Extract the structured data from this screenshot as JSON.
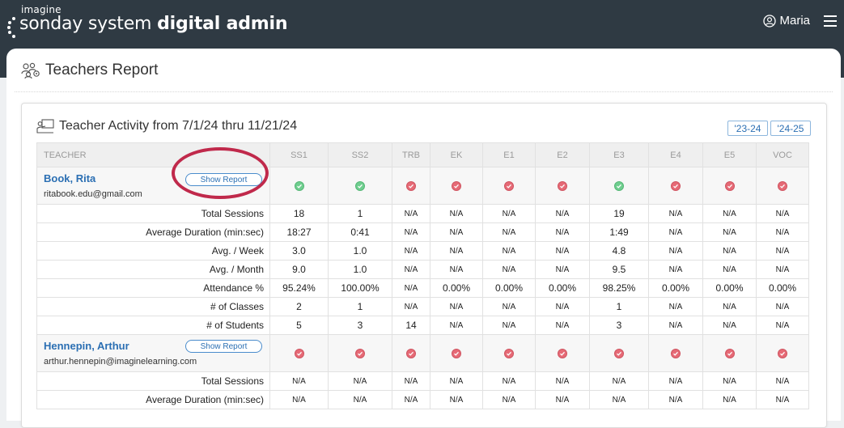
{
  "brand": {
    "small": "imagine",
    "main_light": "sonday system ",
    "main_bold": "digital admin"
  },
  "user": {
    "name": "Maria"
  },
  "page": {
    "title": "Teachers Report"
  },
  "card": {
    "title": "Teacher Activity from 7/1/24 thru 11/21/24",
    "year_buttons": [
      "'23-24",
      "'24-25"
    ]
  },
  "table": {
    "headers": [
      "TEACHER",
      "SS1",
      "SS2",
      "TRB",
      "EK",
      "E1",
      "E2",
      "E3",
      "E4",
      "E5",
      "VOC"
    ],
    "show_report_label": "Show Report",
    "stat_labels": [
      "Total Sessions",
      "Average Duration (min:sec)",
      "Avg. / Week",
      "Avg. / Month",
      "Attendance %",
      "# of Classes",
      "# of Students"
    ],
    "teachers": [
      {
        "name": "Book, Rita",
        "email": "ritabook.edu@gmail.com",
        "status": [
          "ok",
          "ok",
          "bad",
          "bad",
          "bad",
          "bad",
          "ok",
          "bad",
          "bad",
          "bad"
        ],
        "stats": [
          [
            "18",
            "1",
            "N/A",
            "N/A",
            "N/A",
            "N/A",
            "19",
            "N/A",
            "N/A",
            "N/A"
          ],
          [
            "18:27",
            "0:41",
            "N/A",
            "N/A",
            "N/A",
            "N/A",
            "1:49",
            "N/A",
            "N/A",
            "N/A"
          ],
          [
            "3.0",
            "1.0",
            "N/A",
            "N/A",
            "N/A",
            "N/A",
            "4.8",
            "N/A",
            "N/A",
            "N/A"
          ],
          [
            "9.0",
            "1.0",
            "N/A",
            "N/A",
            "N/A",
            "N/A",
            "9.5",
            "N/A",
            "N/A",
            "N/A"
          ],
          [
            "95.24%",
            "100.00%",
            "N/A",
            "0.00%",
            "0.00%",
            "0.00%",
            "98.25%",
            "0.00%",
            "0.00%",
            "0.00%"
          ],
          [
            "2",
            "1",
            "N/A",
            "N/A",
            "N/A",
            "N/A",
            "1",
            "N/A",
            "N/A",
            "N/A"
          ],
          [
            "5",
            "3",
            "14",
            "N/A",
            "N/A",
            "N/A",
            "3",
            "N/A",
            "N/A",
            "N/A"
          ]
        ]
      },
      {
        "name": "Hennepin, Arthur",
        "email": "arthur.hennepin@imaginelearning.com",
        "status": [
          "bad",
          "bad",
          "bad",
          "bad",
          "bad",
          "bad",
          "bad",
          "bad",
          "bad",
          "bad"
        ],
        "stats": [
          [
            "N/A",
            "N/A",
            "N/A",
            "N/A",
            "N/A",
            "N/A",
            "N/A",
            "N/A",
            "N/A",
            "N/A"
          ],
          [
            "N/A",
            "N/A",
            "N/A",
            "N/A",
            "N/A",
            "N/A",
            "N/A",
            "N/A",
            "N/A",
            "N/A"
          ]
        ]
      }
    ]
  }
}
